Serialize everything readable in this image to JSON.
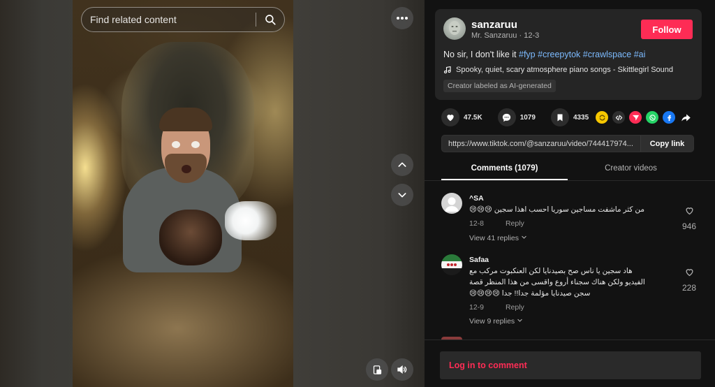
{
  "search": {
    "placeholder": "Find related content"
  },
  "author": {
    "username": "sanzaruu",
    "display_name": "Mr. Sanzaruu",
    "separator": "·",
    "post_date": "12-3",
    "follow_label": "Follow"
  },
  "caption": {
    "text": "No sir, I don't like it",
    "hashtags": [
      "#fyp",
      "#creepytok",
      "#crawlspace",
      "#ai"
    ]
  },
  "music": {
    "title": "Spooky, quiet, scary atmosphere piano songs - Skittlegirl Sound"
  },
  "ai_label": "Creator labeled as AI-generated",
  "actions": {
    "likes": "47.5K",
    "comments": "1079",
    "saves": "4335"
  },
  "share": {
    "icons": [
      "repost-icon",
      "embed-icon",
      "send-icon",
      "whatsapp-icon",
      "facebook-icon",
      "share-arrow-icon"
    ],
    "colors": {
      "repost": "#f6c700",
      "embed": "#2f2f2f",
      "send": "#fe2c55",
      "whatsapp": "#25d366",
      "facebook": "#1877f2"
    }
  },
  "link": {
    "url": "https://www.tiktok.com/@sanzaruu/video/744417974...",
    "copy_label": "Copy link"
  },
  "tabs": {
    "comments": "Comments (1079)",
    "creator_videos": "Creator videos"
  },
  "comments": [
    {
      "username": "^SA",
      "text": "من كثر ماشفت مساجين سوريا احسب اهذا سجين 😢😢😢",
      "date": "12-8",
      "reply_label": "Reply",
      "view_replies": "View 41 replies",
      "likes": "946"
    },
    {
      "username": "Safaa",
      "text": "هاد سجين يا ناس صح بصيدنايا لكن العنكبوت مركب مع الفيديو ولكن هناك سجناء أروع واقسى من هذا المنظر قصة سجن صيدنايا مؤلمة جدا!! جدا 😢😢😢😢",
      "date": "12-9",
      "reply_label": "Reply",
      "view_replies": "View 9 replies",
      "likes": "228"
    }
  ],
  "login": {
    "label": "Log in to comment"
  },
  "colors": {
    "accent": "#fe2c55",
    "hashtag": "#7dbbff",
    "panel": "#252525",
    "background": "#121212"
  }
}
